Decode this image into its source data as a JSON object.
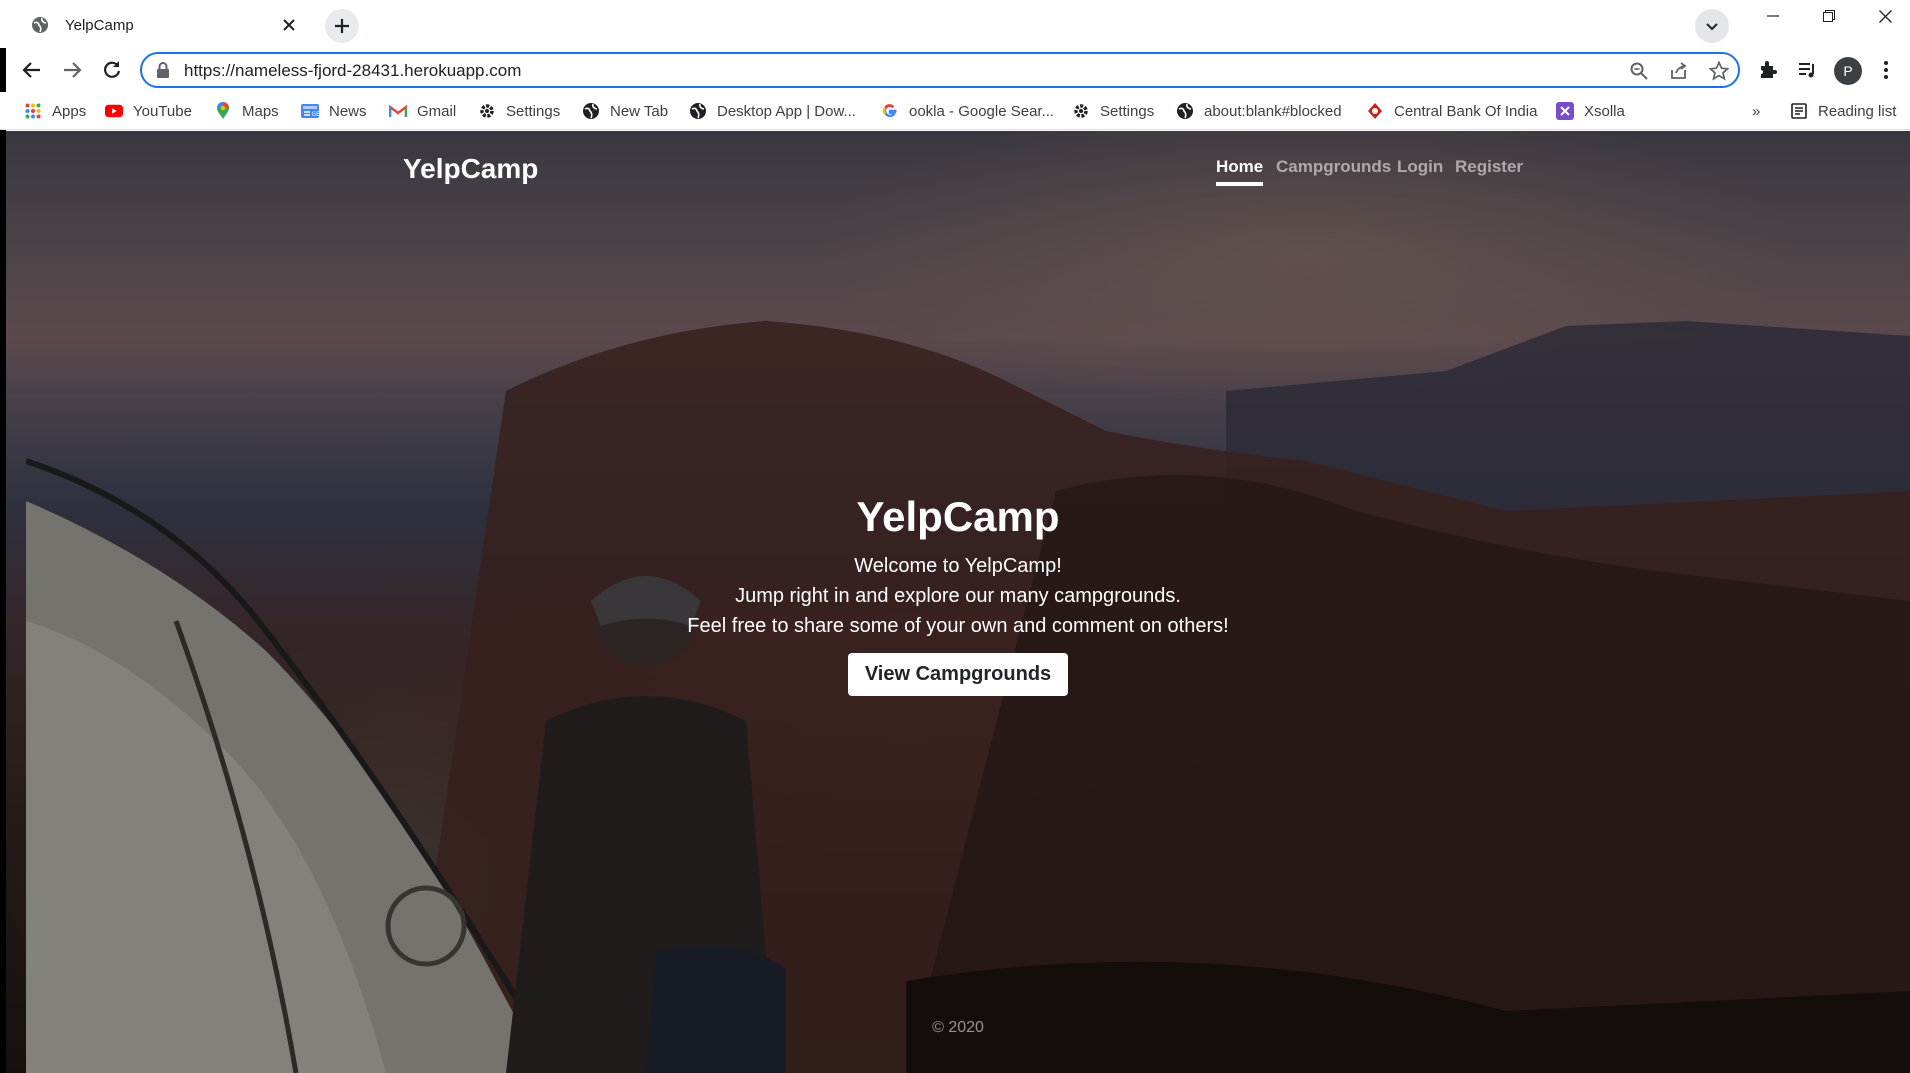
{
  "browser": {
    "tab_title": "YelpCamp",
    "url": "https://nameless-fjord-28431.herokuapp.com",
    "profile_initial": "P",
    "bookmarks": [
      {
        "label": "Apps",
        "icon": "apps-grid-icon"
      },
      {
        "label": "YouTube",
        "icon": "youtube-icon"
      },
      {
        "label": "Maps",
        "icon": "maps-pin-icon"
      },
      {
        "label": "News",
        "icon": "news-icon"
      },
      {
        "label": "Gmail",
        "icon": "gmail-icon"
      },
      {
        "label": "Settings",
        "icon": "gear-icon"
      },
      {
        "label": "New Tab",
        "icon": "globe-icon"
      },
      {
        "label": "Desktop App | Dow...",
        "icon": "globe-icon"
      },
      {
        "label": "ookla - Google Sear...",
        "icon": "google-icon"
      },
      {
        "label": "Settings",
        "icon": "gear-icon"
      },
      {
        "label": "about:blank#blocked",
        "icon": "globe-icon"
      },
      {
        "label": "Central Bank Of India",
        "icon": "bank-icon"
      },
      {
        "label": "Xsolla",
        "icon": "xsolla-icon"
      }
    ],
    "overflow_label": "»",
    "reading_list": "Reading list"
  },
  "site": {
    "brand": "YelpCamp",
    "nav": [
      {
        "label": "Home",
        "active": true
      },
      {
        "label": "Campgrounds",
        "active": false
      },
      {
        "label": "Login",
        "active": false
      },
      {
        "label": "Register",
        "active": false
      }
    ],
    "hero": {
      "title": "YelpCamp",
      "line1": "Welcome to YelpCamp!",
      "line2": "Jump right in and explore our many campgrounds.",
      "line3": "Feel free to share some of your own and comment on others!",
      "cta": "View Campgrounds"
    },
    "footer": "© 2020"
  },
  "colors": {
    "accent_blue": "#1a73e8",
    "youtube_red": "#ff0000",
    "hero_text": "#ffffff"
  }
}
